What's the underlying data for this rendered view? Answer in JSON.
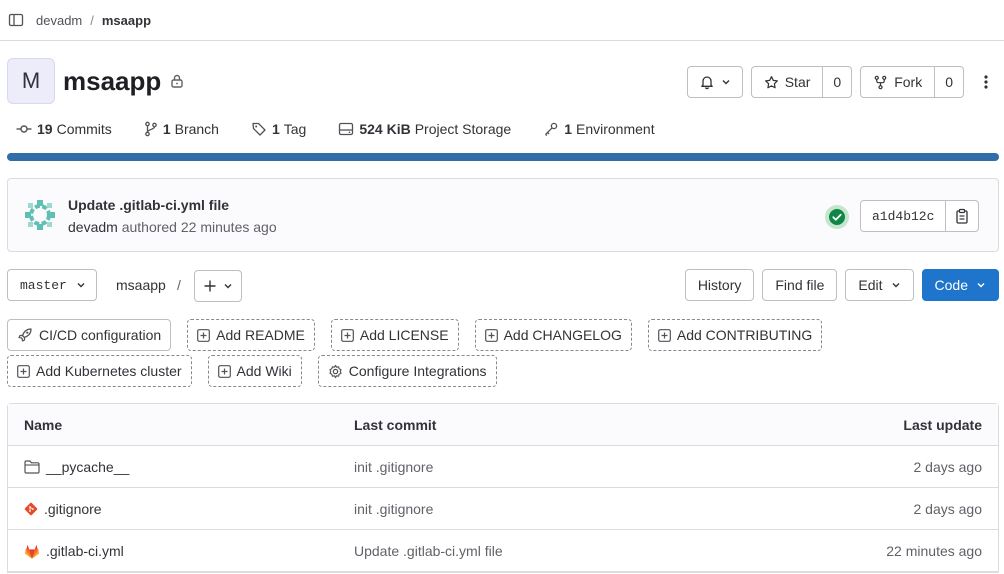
{
  "breadcrumb": {
    "parent": "devadm",
    "current": "msaapp"
  },
  "project": {
    "avatar_letter": "M",
    "name": "msaapp"
  },
  "header_actions": {
    "star_label": "Star",
    "star_count": "0",
    "fork_label": "Fork",
    "fork_count": "0"
  },
  "stats": [
    {
      "count": "19",
      "label": "Commits",
      "icon": "commit-icon"
    },
    {
      "count": "1",
      "label": "Branch",
      "icon": "branch-icon"
    },
    {
      "count": "1",
      "label": "Tag",
      "icon": "tag-icon"
    },
    {
      "count": "524 KiB",
      "label": "Project Storage",
      "icon": "storage-icon"
    },
    {
      "count": "1",
      "label": "Environment",
      "icon": "environment-icon"
    }
  ],
  "language_bar": {
    "fraction": 1.0,
    "color": "#2f6ea8"
  },
  "last_commit": {
    "title": "Update .gitlab-ci.yml file",
    "author": "devadm",
    "authored_text": "authored",
    "time": "22 minutes ago",
    "sha": "a1d4b12c",
    "pipeline_status": "passed"
  },
  "repo_toolbar": {
    "branch": "master",
    "path_root": "msaapp",
    "path_sep": "/",
    "history": "History",
    "find_file": "Find file",
    "edit": "Edit",
    "code": "Code"
  },
  "quick_actions_row1": [
    {
      "label": "CI/CD configuration",
      "icon": "rocket-icon",
      "style": "solid"
    },
    {
      "label": "Add README",
      "icon": "plus-square-icon",
      "style": "dashed"
    },
    {
      "label": "Add LICENSE",
      "icon": "plus-square-icon",
      "style": "dashed"
    },
    {
      "label": "Add CHANGELOG",
      "icon": "plus-square-icon",
      "style": "dashed"
    },
    {
      "label": "Add CONTRIBUTING",
      "icon": "plus-square-icon",
      "style": "dashed"
    }
  ],
  "quick_actions_row2": [
    {
      "label": "Add Kubernetes cluster",
      "icon": "plus-square-icon",
      "style": "dashed"
    },
    {
      "label": "Add Wiki",
      "icon": "plus-square-icon",
      "style": "dashed"
    },
    {
      "label": "Configure Integrations",
      "icon": "settings-icon",
      "style": "dashed"
    }
  ],
  "file_table": {
    "headers": {
      "name": "Name",
      "last_commit": "Last commit",
      "last_update": "Last update"
    },
    "rows": [
      {
        "name": "__pycache__",
        "icon": "folder-icon",
        "commit": "init .gitignore",
        "date": "2 days ago"
      },
      {
        "name": ".gitignore",
        "icon": "git-icon",
        "commit": "init .gitignore",
        "date": "2 days ago"
      },
      {
        "name": ".gitlab-ci.yml",
        "icon": "gitlab-icon",
        "commit": "Update .gitlab-ci.yml file",
        "date": "22 minutes ago"
      }
    ]
  }
}
